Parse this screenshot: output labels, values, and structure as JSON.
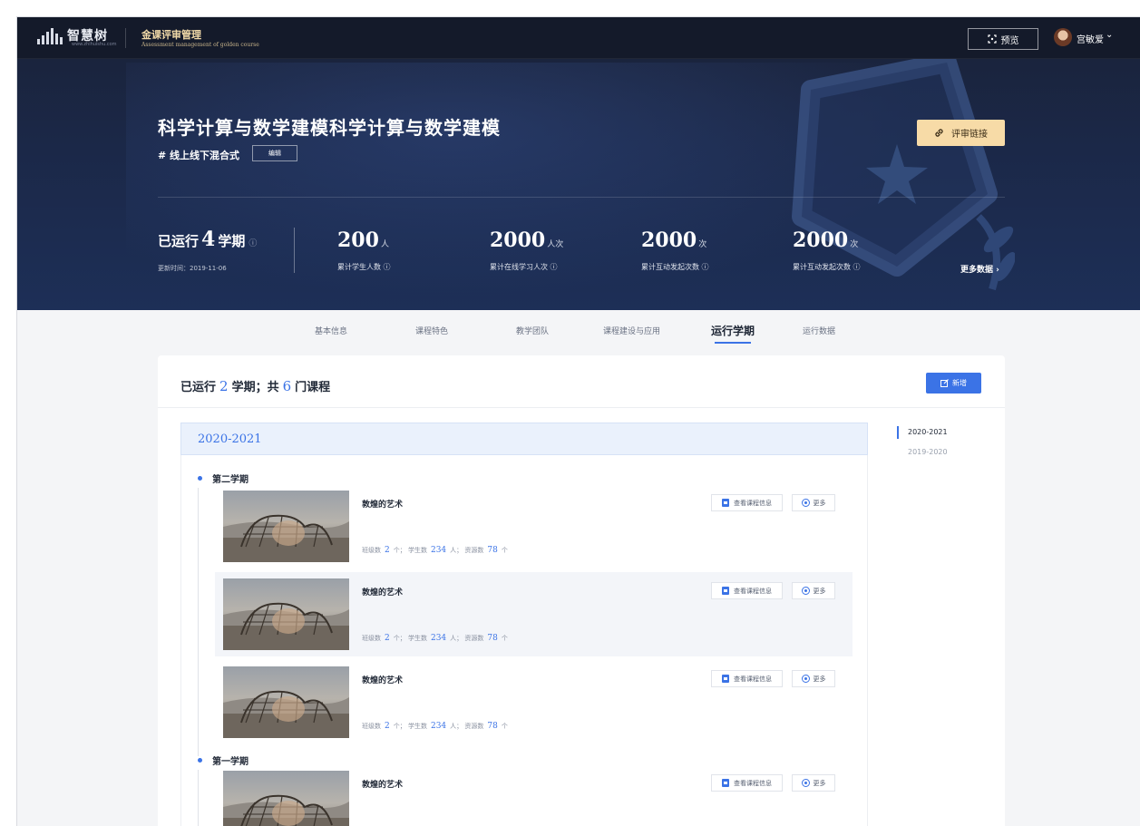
{
  "topbar": {
    "logo_text": "智慧树",
    "logo_sub": "www.zhihuishu.com",
    "app_title": "金课评审管理",
    "app_subtitle": "Assessment management of golden course",
    "preview_label": "预览",
    "user_name": "宫敏爱",
    "user_caret": "⌄"
  },
  "hero": {
    "course_title": "科学计算与数学建模科学计算与数学建模",
    "course_tag": "# 线上线下混合式",
    "edit_label": "编辑",
    "review_link_label": "评审链接",
    "run_prefix": "已运行",
    "run_count": "4",
    "run_suffix": "学期",
    "update_time": "更新时间：2019-11-06",
    "metrics": [
      {
        "value": "200",
        "unit": "人",
        "label": "累计学生人数"
      },
      {
        "value": "2000",
        "unit": "人次",
        "label": "累计在线学习人次"
      },
      {
        "value": "2000",
        "unit": "次",
        "label": "累计互动发起次数"
      },
      {
        "value": "2000",
        "unit": "次",
        "label": "累计互动发起次数"
      }
    ],
    "more_data": "更多数据 ›"
  },
  "tabs": [
    "基本信息",
    "课程特色",
    "教学团队",
    "课程建设与应用",
    "运行学期",
    "运行数据"
  ],
  "active_tab": "运行学期",
  "card": {
    "title_prefix": "已运行",
    "semesters_count": "2",
    "title_mid": "学期；共",
    "courses_count": "6",
    "title_suffix": "门课程",
    "add_label": "新增",
    "year": "2020-2021",
    "semester_2": "第二学期",
    "semester_1": "第一学期",
    "courses": [
      {
        "title": "敦煌的艺术",
        "class_label": "班级数",
        "class_count": "2",
        "class_unit": "个；",
        "student_label": "学生数",
        "student_count": "234",
        "student_unit": "人；",
        "resource_label": "资源数",
        "resource_count": "78",
        "resource_unit": "个"
      },
      {
        "title": "敦煌的艺术",
        "class_label": "班级数",
        "class_count": "2",
        "class_unit": "个；",
        "student_label": "学生数",
        "student_count": "234",
        "student_unit": "人；",
        "resource_label": "资源数",
        "resource_count": "78",
        "resource_unit": "个"
      },
      {
        "title": "敦煌的艺术",
        "class_label": "班级数",
        "class_count": "2",
        "class_unit": "个；",
        "student_label": "学生数",
        "student_count": "234",
        "student_unit": "人；",
        "resource_label": "资源数",
        "resource_count": "78",
        "resource_unit": "个"
      },
      {
        "title": "敦煌的艺术"
      }
    ],
    "info_btn_label": "查看课程信息",
    "more_btn_label": "更多"
  },
  "year_nav": [
    "2020-2021",
    "2019-2020"
  ],
  "colors": {
    "accent": "#3b73e6",
    "gold": "#f7dba7",
    "hero_bg": "#1b2848"
  },
  "icons": [
    "logo-bars-icon",
    "expand-icon",
    "link-icon",
    "info-icon",
    "edit-icon",
    "doc-icon",
    "more-circle-icon",
    "chevron-down-icon"
  ]
}
